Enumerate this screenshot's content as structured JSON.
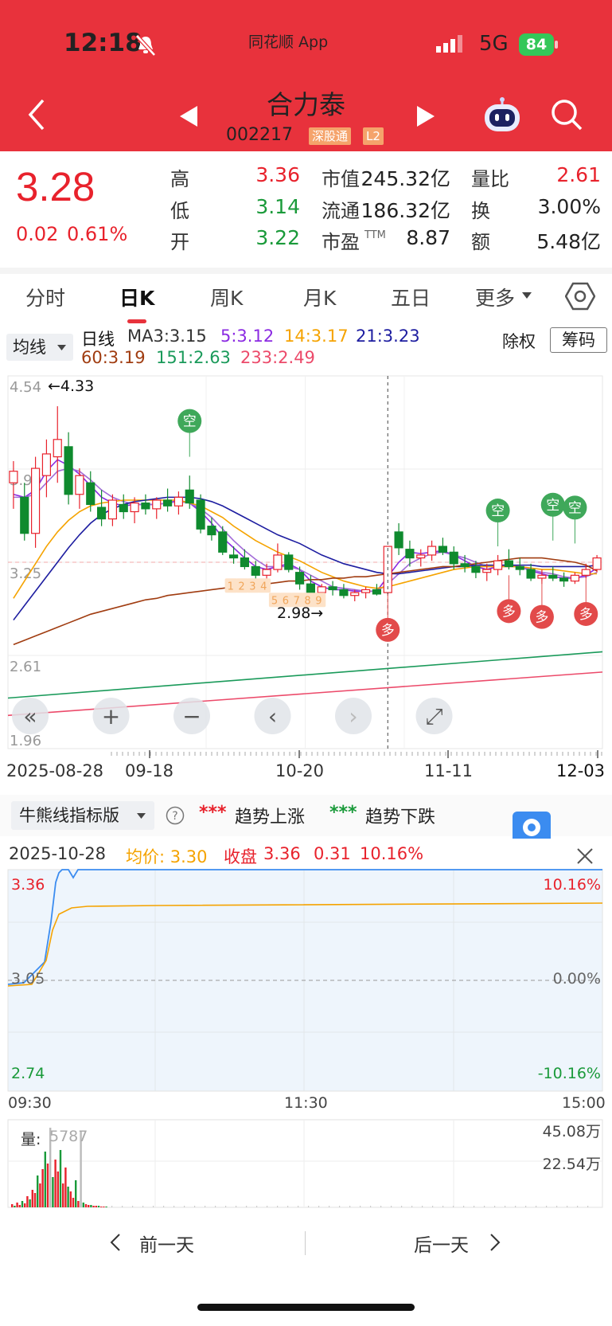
{
  "status_bar": {
    "time": "12:18",
    "app_label": "同花顺 App",
    "network": "5G",
    "battery": "84"
  },
  "header": {
    "name": "合力泰",
    "code": "002217",
    "badge_connect": "深股通",
    "badge_level": "L2"
  },
  "quote": {
    "price": "3.28",
    "change": "0.02",
    "change_pct": "0.61%",
    "stats": [
      {
        "label": "高",
        "value": "3.36"
      },
      {
        "label": "低",
        "value": "3.14"
      },
      {
        "label": "开",
        "value": "3.22"
      },
      {
        "label": "市值",
        "value": "245.32亿"
      },
      {
        "label": "流通",
        "value": "186.32亿"
      },
      {
        "label": "市盈",
        "suffix": "TTM",
        "value": "8.87"
      },
      {
        "label": "量比",
        "value": "2.61"
      },
      {
        "label": "换",
        "value": "3.00%"
      },
      {
        "label": "额",
        "value": "5.48亿"
      }
    ]
  },
  "tabs": [
    "分时",
    "日K",
    "周K",
    "月K",
    "五日",
    "更多"
  ],
  "ma_bar": {
    "selector": "均线",
    "line_name": "日线",
    "ma3": "MA3:3.15",
    "ma5": "5:3.12",
    "ma14": "14:3.17",
    "ma21": "21:3.23",
    "ma60": "60:3.19",
    "ma151": "151:2.63",
    "ma233": "233:2.49",
    "adjust": "除权",
    "chips": "筹码"
  },
  "kchart_labels": {
    "y_ticks": [
      "4.54",
      "3.90",
      "3.25",
      "2.61",
      "1.96"
    ],
    "high_mark": "←4.33",
    "low_mark": "2.98→",
    "x_ticks": [
      "2025-08-28",
      "09-18",
      "10-20",
      "11-11",
      "12-03"
    ],
    "signal_short": "空",
    "signal_long": "多",
    "countdown": [
      "1",
      "2",
      "3",
      "4",
      "5",
      "6",
      "7",
      "8",
      "9"
    ]
  },
  "indicator": {
    "selector": "牛熊线指标版",
    "up_label": "趋势上涨",
    "down_label": "趋势下跌",
    "up_marks": "***",
    "down_marks": "***"
  },
  "minute": {
    "date": "2025-10-28",
    "avg_label": "均价: 3.30",
    "close_label": "收盘",
    "close": "3.36",
    "chg": "0.31",
    "chg_pct": "10.16%",
    "price_hi": "3.36",
    "price_mid": "3.05",
    "price_lo": "2.74",
    "pct_hi": "10.16%",
    "pct_mid": "0.00%",
    "pct_lo": "-10.16%",
    "time_ticks": [
      "09:30",
      "11:30",
      "15:00"
    ],
    "vol_label": "量:",
    "vol_value": "5787",
    "vol_hi": "45.08万",
    "vol_mid": "22.54万"
  },
  "day_nav": {
    "prev": "前一天",
    "next": "后一天"
  },
  "chart_data": {
    "type": "candlestick",
    "title": "日K",
    "ylim": [
      1.96,
      4.54
    ],
    "x_ticks": [
      "2025-08-28",
      "09-18",
      "10-20",
      "11-11",
      "12-03"
    ],
    "ohlc": [
      [
        3.8,
        3.95,
        3.62,
        3.88
      ],
      [
        3.7,
        3.8,
        3.4,
        3.45
      ],
      [
        3.45,
        3.98,
        3.35,
        3.9
      ],
      [
        3.85,
        4.1,
        3.7,
        4.0
      ],
      [
        3.98,
        4.33,
        3.8,
        4.1
      ],
      [
        4.05,
        4.15,
        3.65,
        3.72
      ],
      [
        3.72,
        3.9,
        3.62,
        3.85
      ],
      [
        3.8,
        3.88,
        3.6,
        3.65
      ],
      [
        3.63,
        3.75,
        3.5,
        3.55
      ],
      [
        3.55,
        3.72,
        3.5,
        3.68
      ],
      [
        3.65,
        3.72,
        3.55,
        3.6
      ],
      [
        3.6,
        3.7,
        3.52,
        3.66
      ],
      [
        3.66,
        3.72,
        3.58,
        3.62
      ],
      [
        3.62,
        3.7,
        3.55,
        3.68
      ],
      [
        3.68,
        3.76,
        3.6,
        3.64
      ],
      [
        3.64,
        3.74,
        3.58,
        3.7
      ],
      [
        3.75,
        3.85,
        3.62,
        3.66
      ],
      [
        3.68,
        3.72,
        3.45,
        3.48
      ],
      [
        3.5,
        3.56,
        3.4,
        3.44
      ],
      [
        3.46,
        3.5,
        3.3,
        3.32
      ],
      [
        3.3,
        3.36,
        3.24,
        3.28
      ],
      [
        3.28,
        3.34,
        3.2,
        3.22
      ],
      [
        3.22,
        3.26,
        3.12,
        3.16
      ],
      [
        3.16,
        3.24,
        3.1,
        3.2
      ],
      [
        3.2,
        3.38,
        3.18,
        3.3
      ],
      [
        3.3,
        3.32,
        3.18,
        3.2
      ],
      [
        3.18,
        3.22,
        3.06,
        3.1
      ],
      [
        3.1,
        3.16,
        3.02,
        3.04
      ],
      [
        3.04,
        3.1,
        2.98,
        3.08
      ],
      [
        3.08,
        3.12,
        3.02,
        3.06
      ],
      [
        3.06,
        3.1,
        3.0,
        3.02
      ],
      [
        3.02,
        3.06,
        2.98,
        3.04
      ],
      [
        3.04,
        3.08,
        3.0,
        3.06
      ],
      [
        3.06,
        3.1,
        3.02,
        3.03
      ],
      [
        3.04,
        3.36,
        3.03,
        3.36
      ],
      [
        3.46,
        3.52,
        3.3,
        3.35
      ],
      [
        3.34,
        3.4,
        3.22,
        3.28
      ],
      [
        3.28,
        3.34,
        3.22,
        3.3
      ],
      [
        3.3,
        3.4,
        3.26,
        3.36
      ],
      [
        3.36,
        3.42,
        3.3,
        3.32
      ],
      [
        3.32,
        3.36,
        3.2,
        3.24
      ],
      [
        3.24,
        3.3,
        3.18,
        3.22
      ],
      [
        3.22,
        3.26,
        3.14,
        3.18
      ],
      [
        3.18,
        3.24,
        3.12,
        3.2
      ],
      [
        3.2,
        3.3,
        3.16,
        3.26
      ],
      [
        3.26,
        3.34,
        3.2,
        3.22
      ],
      [
        3.22,
        3.28,
        3.16,
        3.2
      ],
      [
        3.2,
        3.24,
        3.12,
        3.14
      ],
      [
        3.14,
        3.2,
        3.1,
        3.16
      ],
      [
        3.16,
        3.22,
        3.12,
        3.14
      ],
      [
        3.14,
        3.18,
        3.08,
        3.12
      ],
      [
        3.12,
        3.18,
        3.1,
        3.16
      ],
      [
        3.16,
        3.24,
        3.14,
        3.2
      ],
      [
        3.2,
        3.3,
        3.18,
        3.28
      ]
    ],
    "ma_series": [
      {
        "name": "MA3",
        "color": "#8b2be2",
        "values": [
          3.72,
          3.7,
          3.75,
          3.88,
          3.96,
          3.92,
          3.86,
          3.78,
          3.7,
          3.66,
          3.64,
          3.65,
          3.65,
          3.65,
          3.66,
          3.68,
          3.66,
          3.6,
          3.52,
          3.42,
          3.35,
          3.28,
          3.22,
          3.2,
          3.22,
          3.24,
          3.2,
          3.12,
          3.08,
          3.06,
          3.06,
          3.05,
          3.05,
          3.05,
          3.15,
          3.25,
          3.32,
          3.31,
          3.32,
          3.33,
          3.3,
          3.26,
          3.22,
          3.2,
          3.22,
          3.23,
          3.22,
          3.19,
          3.17,
          3.15,
          3.14,
          3.14,
          3.16,
          3.21
        ]
      },
      {
        "name": "MA5",
        "color": "#a26bd8",
        "values": [
          3.7,
          3.7,
          3.72,
          3.8,
          3.88,
          3.9,
          3.88,
          3.82,
          3.75,
          3.7,
          3.67,
          3.65,
          3.65,
          3.65,
          3.66,
          3.67,
          3.66,
          3.62,
          3.56,
          3.48,
          3.4,
          3.33,
          3.27,
          3.22,
          3.22,
          3.22,
          3.2,
          3.16,
          3.12,
          3.08,
          3.07,
          3.06,
          3.05,
          3.05,
          3.1,
          3.17,
          3.24,
          3.28,
          3.31,
          3.32,
          3.3,
          3.28,
          3.25,
          3.22,
          3.22,
          3.22,
          3.22,
          3.2,
          3.18,
          3.17,
          3.15,
          3.14,
          3.15,
          3.18
        ]
      },
      {
        "name": "MA14",
        "color": "#f5a300",
        "values": [
          3.0,
          3.12,
          3.24,
          3.36,
          3.46,
          3.54,
          3.6,
          3.64,
          3.66,
          3.67,
          3.68,
          3.68,
          3.68,
          3.68,
          3.68,
          3.68,
          3.66,
          3.64,
          3.6,
          3.56,
          3.5,
          3.45,
          3.4,
          3.36,
          3.32,
          3.29,
          3.26,
          3.22,
          3.18,
          3.15,
          3.12,
          3.1,
          3.08,
          3.07,
          3.08,
          3.1,
          3.12,
          3.14,
          3.16,
          3.18,
          3.2,
          3.21,
          3.22,
          3.22,
          3.22,
          3.22,
          3.22,
          3.21,
          3.2,
          3.2,
          3.19,
          3.18,
          3.17,
          3.17
        ]
      },
      {
        "name": "MA21",
        "color": "#1d1da0",
        "values": [
          2.85,
          2.95,
          3.05,
          3.15,
          3.25,
          3.35,
          3.44,
          3.52,
          3.58,
          3.62,
          3.65,
          3.67,
          3.68,
          3.69,
          3.7,
          3.7,
          3.7,
          3.69,
          3.67,
          3.64,
          3.6,
          3.56,
          3.52,
          3.48,
          3.44,
          3.41,
          3.38,
          3.34,
          3.3,
          3.27,
          3.24,
          3.22,
          3.2,
          3.18,
          3.17,
          3.17,
          3.18,
          3.19,
          3.2,
          3.21,
          3.22,
          3.22,
          3.23,
          3.23,
          3.23,
          3.23,
          3.23,
          3.23,
          3.22,
          3.22,
          3.22,
          3.22,
          3.22,
          3.23
        ]
      },
      {
        "name": "MA60",
        "color": "#a03c10",
        "values": [
          2.68,
          2.71,
          2.74,
          2.77,
          2.8,
          2.83,
          2.86,
          2.89,
          2.91,
          2.93,
          2.95,
          2.97,
          2.99,
          3.0,
          3.02,
          3.03,
          3.04,
          3.05,
          3.06,
          3.07,
          3.08,
          3.09,
          3.1,
          3.1,
          3.11,
          3.12,
          3.12,
          3.13,
          3.13,
          3.14,
          3.14,
          3.15,
          3.15,
          3.16,
          3.17,
          3.18,
          3.19,
          3.2,
          3.21,
          3.22,
          3.22,
          3.23,
          3.24,
          3.25,
          3.26,
          3.27,
          3.28,
          3.28,
          3.28,
          3.27,
          3.26,
          3.25,
          3.23,
          3.19
        ]
      },
      {
        "name": "MA151",
        "color": "#1a9a5a",
        "values": [
          2.31,
          2.63
        ]
      },
      {
        "name": "MA233",
        "color": "#ec4a6a",
        "values": [
          2.19,
          2.49
        ]
      }
    ]
  }
}
